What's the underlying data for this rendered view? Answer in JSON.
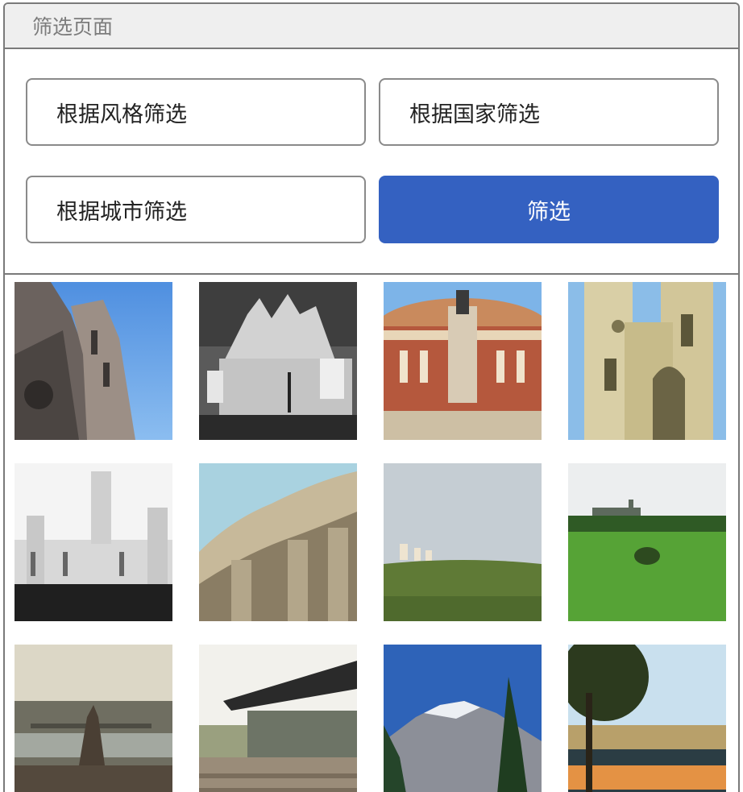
{
  "header": {
    "title": "筛选页面"
  },
  "filters": {
    "style_label": "根据风格筛选",
    "country_label": "根据国家筛选",
    "city_label": "根据城市筛选",
    "submit_label": "筛选"
  },
  "colors": {
    "accent": "#3461c1",
    "border": "#7a7a7a",
    "header_bg": "#efefef"
  },
  "gallery": {
    "image_count": 12,
    "columns": 4
  }
}
